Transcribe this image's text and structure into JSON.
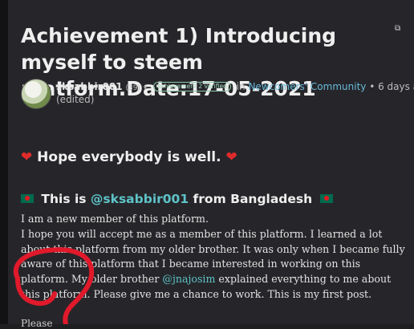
{
  "post": {
    "title": "Achievement 1) Introducing myself to steem platform.Date:17-05-2021",
    "author": "sksabbir001",
    "reputation": "(39)",
    "badge": "achievement 2 verified",
    "in_word": "in",
    "community": "Newcomers' Community",
    "time": "• 6 days ago",
    "edited": "(edited)"
  },
  "content": {
    "greeting": "Hope everybody is well.",
    "heading_prefix": "This is",
    "heading_mention": "@sksabbir001",
    "heading_suffix": "from Bangladesh",
    "line1": "I am a new member of this platform.",
    "line2": "I hope you will accept me as a member of this platform. I learned a lot about this platform from my older brother. It was only when I became fully aware of this platform that I became interested in working on this platform. My older brother",
    "mention2": "@jnajosim",
    "line3": "explained everything to me about this platform. Please give me a chance to work. This is my first post.",
    "cut_line": "Please"
  },
  "icons": {
    "heart": "red-heart-icon",
    "flag": "bangladesh-flag-icon",
    "caret": "caret-down-icon",
    "corner": "reblog-icon"
  },
  "colors": {
    "background": "#26262a",
    "link": "#5ec3c8",
    "community": "#68b8d8",
    "badge": "#9fd6b8",
    "annotation": "#e0192b"
  }
}
